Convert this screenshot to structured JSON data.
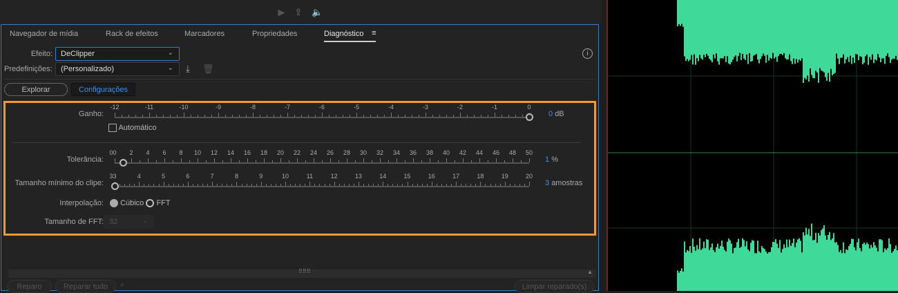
{
  "transport": {
    "play_icon": "play-icon",
    "export_icon": "export-icon",
    "speaker_icon": "speaker-icon"
  },
  "tabs": [
    {
      "label": "Navegador de mídia"
    },
    {
      "label": "Rack de efeitos"
    },
    {
      "label": "Marcadores"
    },
    {
      "label": "Propriedades"
    },
    {
      "label": "Diagnóstico",
      "active": true
    }
  ],
  "effect": {
    "label": "Efeito:",
    "value": "DeClipper"
  },
  "preset": {
    "label": "Predefinições:",
    "value": "(Personalizado)"
  },
  "mode_buttons": {
    "explore": "Explorar",
    "settings": "Configurações"
  },
  "gain": {
    "label": "Ganho:",
    "min": -12,
    "max": 0,
    "value": 0,
    "value_text": "0",
    "unit": "dB",
    "ticks": [
      "-12",
      "-11",
      "-10",
      "-9",
      "-8",
      "-7",
      "-6",
      "-5",
      "-4",
      "-3",
      "-2",
      "-1",
      "0"
    ]
  },
  "auto": {
    "label": "Automático",
    "checked": false
  },
  "tolerance": {
    "label": "Tolerância:",
    "min": 0,
    "max": 50,
    "value": 1,
    "value_text": "1",
    "unit": "%",
    "min_label": "0",
    "ticks": [
      "0",
      "2",
      "4",
      "6",
      "8",
      "10",
      "12",
      "14",
      "16",
      "18",
      "20",
      "22",
      "24",
      "26",
      "28",
      "30",
      "32",
      "34",
      "36",
      "38",
      "40",
      "42",
      "44",
      "46",
      "48",
      "50"
    ]
  },
  "clip_size": {
    "label": "Tamanho mínimo do clipe:",
    "min": 3,
    "max": 20,
    "value": 3,
    "value_text": "3",
    "unit": "amostras",
    "min_label": "3",
    "ticks": [
      "3",
      "4",
      "5",
      "6",
      "7",
      "8",
      "9",
      "10",
      "11",
      "12",
      "13",
      "14",
      "15",
      "16",
      "17",
      "18",
      "19",
      "20"
    ]
  },
  "interp": {
    "label": "Interpolação:",
    "options": [
      "Cúbico",
      "FFT"
    ],
    "selected": "Cúbico"
  },
  "fft": {
    "label": "Tamanho de FFT:",
    "value": "32"
  },
  "bottom": {
    "repair": "Reparo",
    "repair_all": "Reparar tudo",
    "clear": "Limpar reparado(s)"
  },
  "colors": {
    "accent": "#3f8fe8",
    "highlight": "#f29a2e",
    "waveform": "#3fd99a"
  }
}
